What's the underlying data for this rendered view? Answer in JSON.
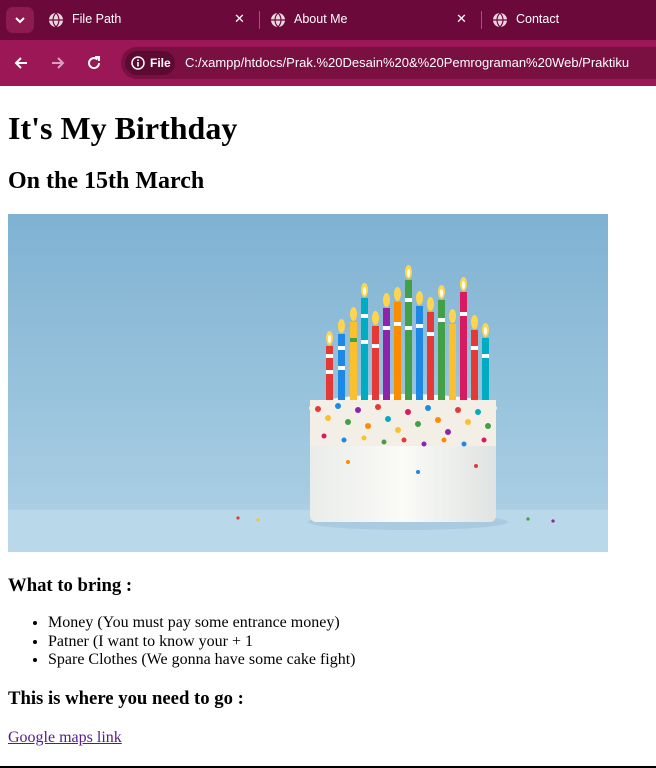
{
  "browser": {
    "tabs": [
      {
        "label": "File Path",
        "icon": "globe-icon"
      },
      {
        "label": "About Me",
        "icon": "globe-icon"
      },
      {
        "label": "Contact",
        "icon": "globe-icon"
      }
    ],
    "close_glyph": "✕",
    "address": {
      "chip_label": "File",
      "url": "C:/xampp/htdocs/Prak.%20Desain%20&%20Pemrograman%20Web/Praktiku"
    },
    "colors": {
      "tab_strip": "#6b0a3a",
      "toolbar": "#9c1756",
      "omnibox": "#7a0f42"
    }
  },
  "page": {
    "title": "It's My Birthday",
    "subtitle": "On the 15th March",
    "bring_heading": "What to bring :",
    "bring_items": [
      "Money (You must pay some entrance money)",
      "Patner (I want to know your + 1",
      "Spare Clothes (We gonna have some cake fight)"
    ],
    "where_heading": "This is where you need to go :",
    "maps_link": "Google maps link"
  }
}
